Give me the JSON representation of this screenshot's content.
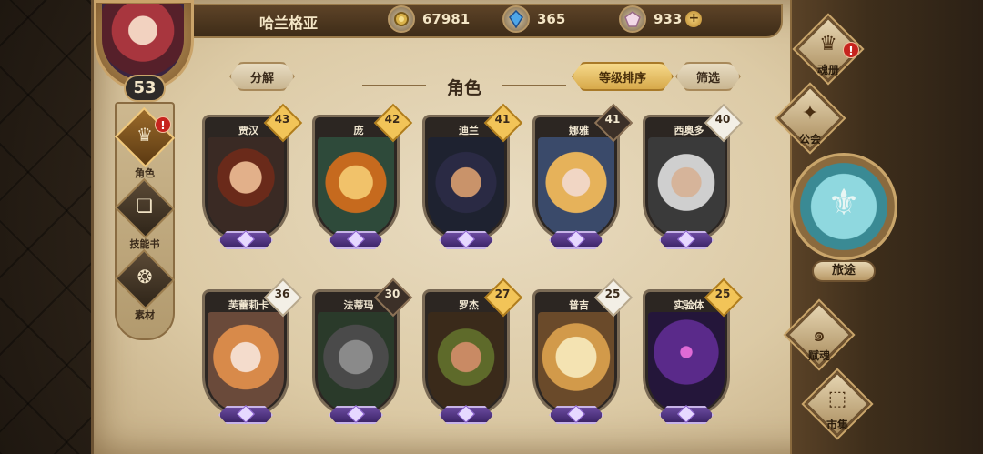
{
  "player": {
    "name": "哈兰格亚",
    "level": "53"
  },
  "resources": [
    {
      "icon": "gold-coin-icon",
      "value": "67981"
    },
    {
      "icon": "blue-crystal-icon",
      "value": "365"
    },
    {
      "icon": "pink-gem-icon",
      "value": "933",
      "has_plus": true
    }
  ],
  "left_tabs": [
    {
      "name": "heroes-tab",
      "label": "角色",
      "icon": "helmet-icon",
      "active": true,
      "alert": "!"
    },
    {
      "name": "skillbooks-tab",
      "label": "技能书",
      "icon": "book-icon",
      "active": false
    },
    {
      "name": "materials-tab",
      "label": "素材",
      "icon": "owl-icon",
      "active": false
    }
  ],
  "header": {
    "decompose_label": "分解",
    "title": "角色",
    "sort_label": "等级排序",
    "filter_label": "筛选"
  },
  "heroes": [
    {
      "name": "贾汉",
      "level": "43",
      "badge": "gold",
      "art": "bearded-warrior"
    },
    {
      "name": "庞",
      "level": "42",
      "badge": "gold",
      "art": "tiger"
    },
    {
      "name": "迪兰",
      "level": "41",
      "badge": "gold",
      "art": "dark-haired-man"
    },
    {
      "name": "娜雅",
      "level": "41",
      "badge": "dark",
      "art": "blonde-girl"
    },
    {
      "name": "西奥多",
      "level": "40",
      "badge": "white",
      "art": "grey-haired-man"
    },
    {
      "name": "芙蕾莉卡",
      "level": "36",
      "badge": "white",
      "art": "ginger-girl"
    },
    {
      "name": "法蒂玛",
      "level": "30",
      "badge": "dark",
      "art": "grey-wolf"
    },
    {
      "name": "罗杰",
      "level": "27",
      "badge": "gold",
      "art": "bandana-man"
    },
    {
      "name": "普吉",
      "level": "25",
      "badge": "white",
      "art": "owl-chick"
    },
    {
      "name": "实验体",
      "level": "25",
      "badge": "gold",
      "art": "purple-golem"
    }
  ],
  "right_nav": {
    "soul_book": {
      "label": "魂册",
      "alert": "!"
    },
    "guild": {
      "label": "公会"
    },
    "journey": {
      "label": "旅途"
    },
    "soul_gift": {
      "label": "赋魂"
    },
    "market": {
      "label": "市集"
    }
  },
  "colors": {
    "parchment": "#dccaa5",
    "gold_badge": "#f2c458",
    "gem_purple": "#6a4a9e",
    "journey_teal": "#8fd8df",
    "alert_red": "#c6241e"
  }
}
